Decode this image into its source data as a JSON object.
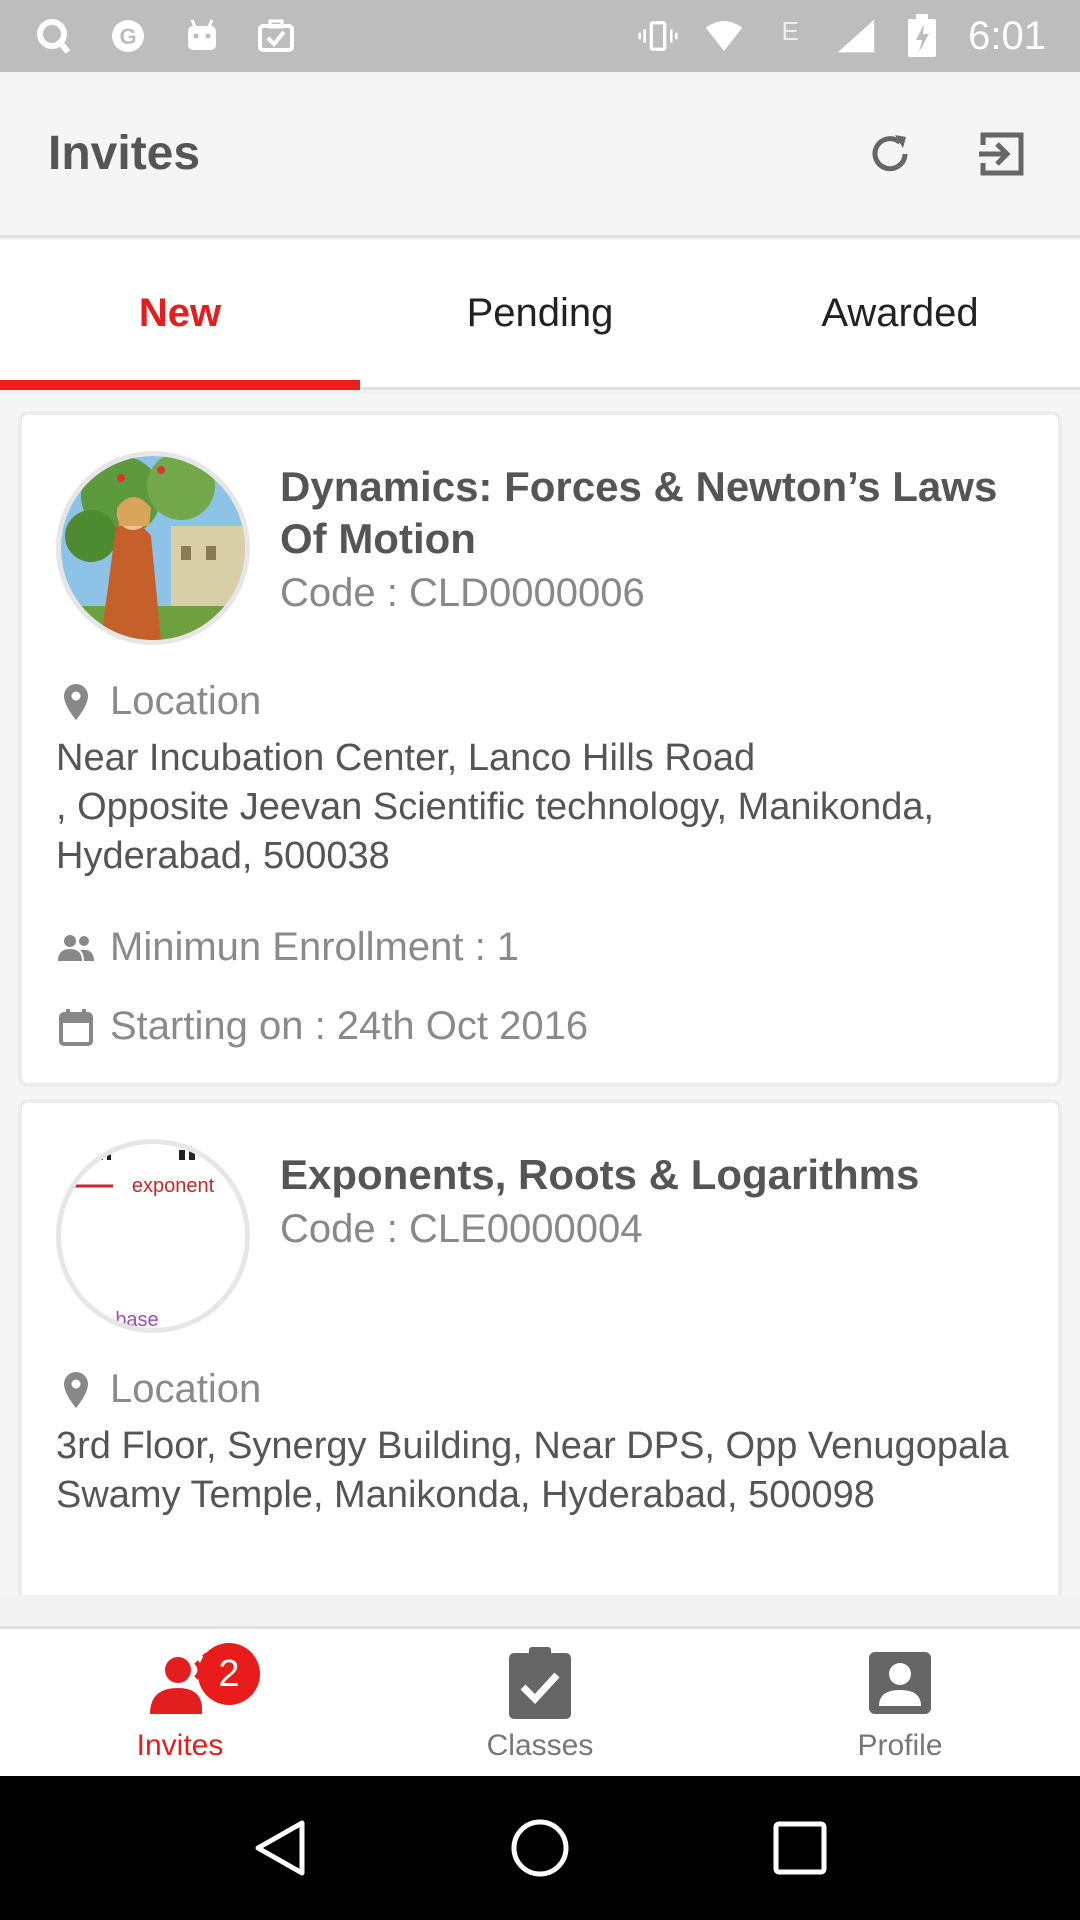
{
  "status_bar": {
    "time": "6:01",
    "network_label": "E",
    "left_icons": [
      "q-icon",
      "g-icon",
      "android-icon",
      "briefcase-check-icon"
    ],
    "right_icons": [
      "vibrate-icon",
      "wifi-icon",
      "signal-icon",
      "battery-charging-icon"
    ]
  },
  "app_bar": {
    "title": "Invites",
    "actions": [
      {
        "name": "refresh-icon"
      },
      {
        "name": "logout-icon"
      }
    ]
  },
  "tabs": [
    {
      "label": "New",
      "active": true
    },
    {
      "label": "Pending",
      "active": false
    },
    {
      "label": "Awarded",
      "active": false
    }
  ],
  "invites": [
    {
      "title": "Dynamics: Forces & Newton’s Laws Of Motion",
      "code": "Code : CLD0000006",
      "location_label": "Location",
      "address": "Near Incubation Center, Lanco Hills Road\n, Opposite Jeevan Scientific technology, Manikonda, Hyderabad, 500038",
      "min_enrollment": "Minimun Enrollment : 1",
      "starting_on": "Starting on : 24th Oct 2016"
    },
    {
      "title": "Exponents, Roots & Logarithms",
      "code": "Code : CLE0000004",
      "location_label": "Location",
      "address": "3rd Floor, Synergy Building, Near DPS, Opp Venugopala Swamy Temple, Manikonda, Hyderabad, 500098",
      "thumb_text_top": "exponent",
      "thumb_text_bottom": "base"
    }
  ],
  "bottom_nav": [
    {
      "label": "Invites",
      "icon": "invites-icon",
      "active": true,
      "badge": "2"
    },
    {
      "label": "Classes",
      "icon": "classes-check-icon",
      "active": false
    },
    {
      "label": "Profile",
      "icon": "profile-icon",
      "active": false
    }
  ],
  "colors": {
    "accent": "#e31e1e",
    "status_bar": "#bdbdbd",
    "system_nav": "#000000"
  }
}
